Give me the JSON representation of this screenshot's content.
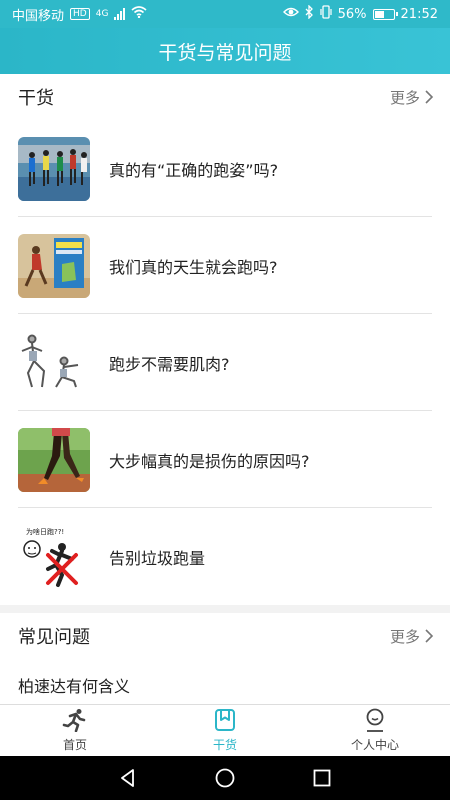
{
  "status": {
    "carrier": "中国移动",
    "hd": "HD",
    "network": "4G",
    "battery": "56%",
    "battery_level": 0.56,
    "time": "21:52"
  },
  "header": {
    "title": "干货与常见问题"
  },
  "ganhuo": {
    "title": "干货",
    "more": "更多",
    "articles": [
      {
        "title": "真的有“正确的跑姿”吗?",
        "thumb": "runners-race-image"
      },
      {
        "title": "我们真的天生就会跑吗?",
        "thumb": "book-cover-runner-image"
      },
      {
        "title": "跑步不需要肌肉?",
        "thumb": "stretch-illustration-image"
      },
      {
        "title": "大步幅真的是损伤的原因吗?",
        "thumb": "runner-legs-track-image"
      },
      {
        "title": "告别垃圾跑量",
        "thumb": "crossed-runner-cartoon-image"
      }
    ]
  },
  "thumb_text": {
    "meme": "为啥日跑??!"
  },
  "faq": {
    "title": "常见问题",
    "more": "更多",
    "items": [
      {
        "title": "柏速达有何含义"
      }
    ]
  },
  "tabs": [
    {
      "label": "首页",
      "icon": "runner-icon"
    },
    {
      "label": "干货",
      "icon": "bookmark-icon",
      "active": true
    },
    {
      "label": "个人中心",
      "icon": "person-icon"
    }
  ],
  "colors": {
    "accent": "#2bb6c8",
    "cross": "#e02020"
  }
}
